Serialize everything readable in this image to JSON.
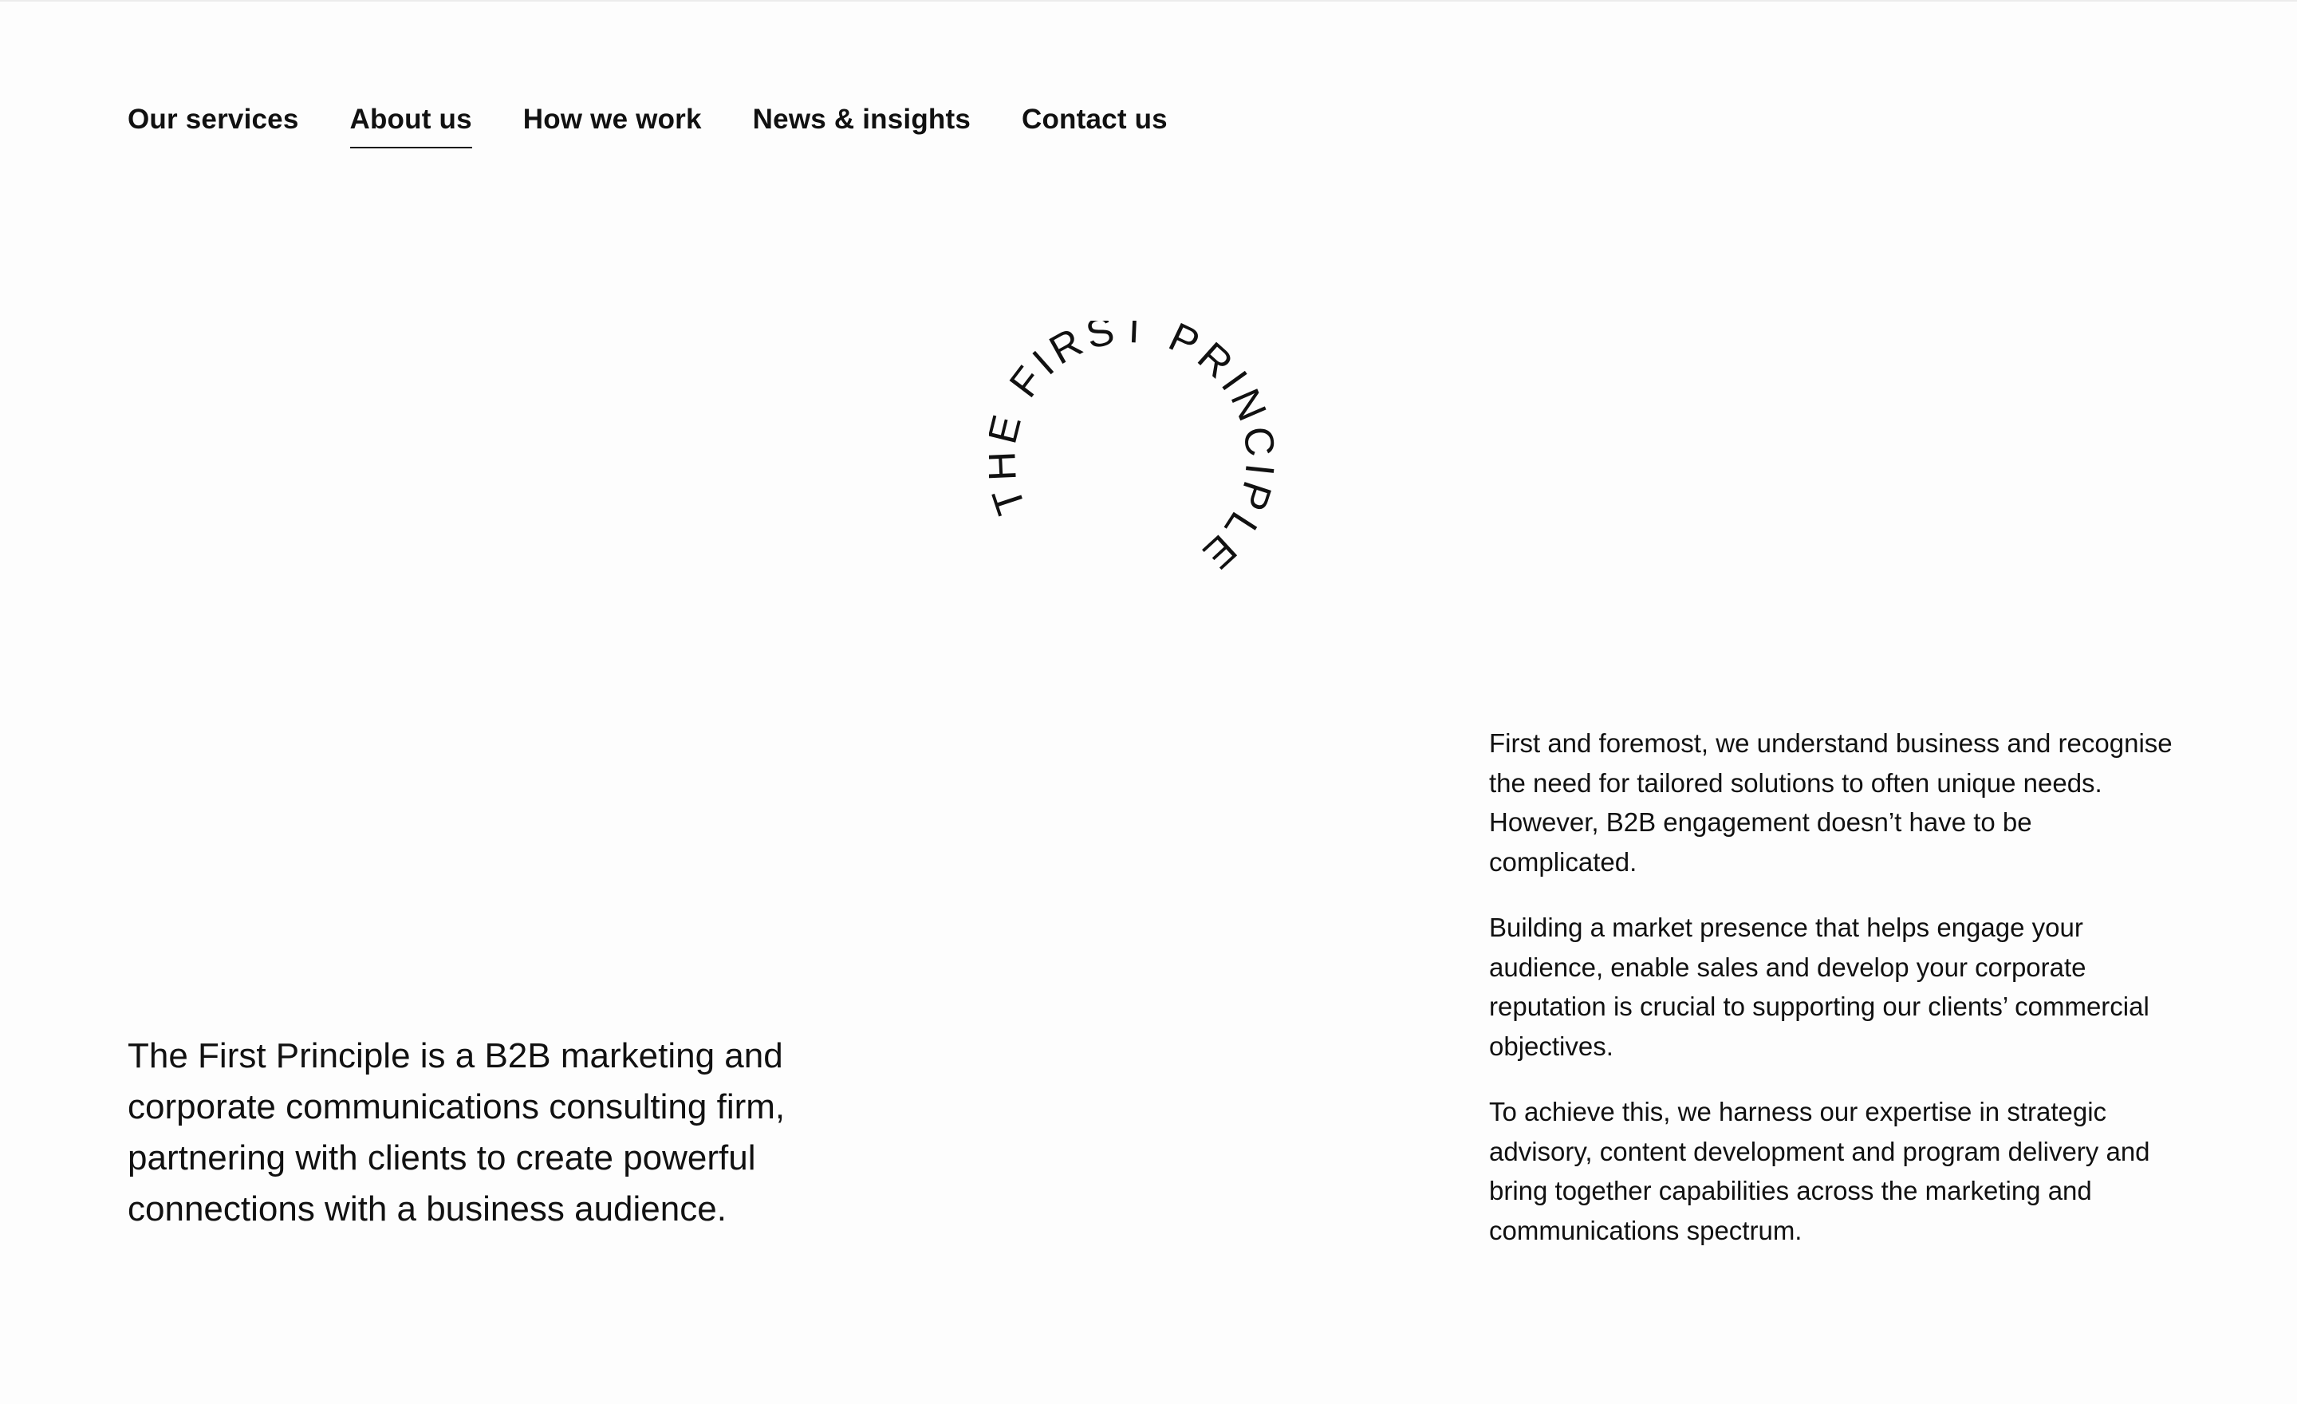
{
  "nav": {
    "items": [
      {
        "label": "Our services"
      },
      {
        "label": "About us",
        "active": true
      },
      {
        "label": "How we work"
      },
      {
        "label": "News & insights"
      },
      {
        "label": "Contact us"
      }
    ]
  },
  "logo": {
    "text": "THE FIRST PRINCIPLE."
  },
  "intro": {
    "lead": "The First Principle is a B2B marketing and corporate communications consulting firm, partnering with clients to create powerful connections with a business audience."
  },
  "body": {
    "paragraphs": [
      "First and foremost, we understand business and recognise the need for tailored solutions to often unique needs. However, B2B engagement doesn’t have to be complicated.",
      "Building a market presence that helps engage your audience, enable sales and develop your corporate reputation is crucial to supporting our clients’ commercial objectives.",
      "To achieve this, we harness our expertise in strategic advisory, content development and program delivery and bring together capabilities across the marketing and communications spectrum."
    ]
  },
  "colors": {
    "background": "#fdfdfd",
    "text": "#111111"
  }
}
